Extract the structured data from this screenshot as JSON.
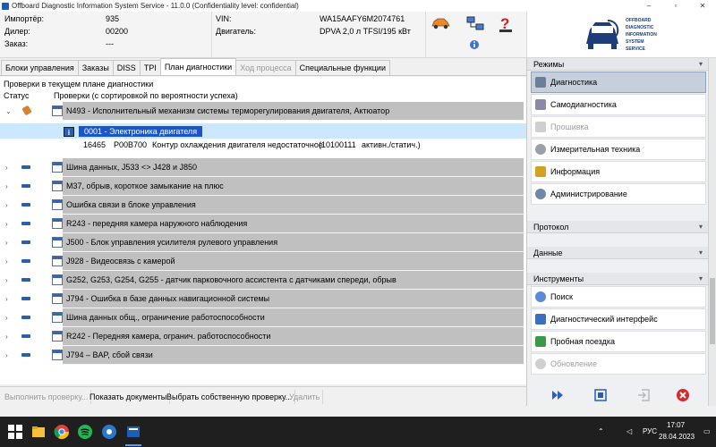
{
  "window": {
    "title": "Offboard Diagnostic Information System Service - 11.0.0 (Confidentiality level: confidential)",
    "minimize": "–",
    "maximize": "▫",
    "close": "✕"
  },
  "header": {
    "importer_label": "Импортёр:",
    "importer_value": "935",
    "dealer_label": "Дилер:",
    "dealer_value": "00200",
    "order_label": "Заказ:",
    "order_value": "---",
    "vin_label": "VIN:",
    "vin_value": "WA15AAFY6M2074761",
    "engine_label": "Двигатель:",
    "engine_value": "DPVA 2,0 л TFSI/195 кВт"
  },
  "logo": {
    "line1": "OFFBOARD",
    "line2": "DIAGNOSTIC",
    "line3": "INFORMATION",
    "line4": "SYSTEM",
    "line5": "SERVICE"
  },
  "tabs": [
    {
      "label": "Блоки управления"
    },
    {
      "label": "Заказы"
    },
    {
      "label": "DISS"
    },
    {
      "label": "TPI"
    },
    {
      "label": "План диагностики"
    },
    {
      "label": "Ход процесса"
    },
    {
      "label": "Специальные функции"
    }
  ],
  "main": {
    "caption": "Проверки в текущем плане диагностики",
    "col_status": "Статус",
    "col_checks": "Проверки (с сортировкой по вероятности успеха)",
    "first_row": "N493 - Исполнительный механизм системы терморегулирования двигателя, Актюатор",
    "sub_selected": "0001 - Электроника двигателя",
    "sub_info_icon": "i",
    "detail_code": "16465",
    "detail_pcode": "P00B700",
    "detail_text": "Контур охлаждения двигателя недостаточное",
    "detail_bits": "(10100111",
    "detail_state": "активн./статич.)",
    "rows": [
      "Шина данных, J533 <> J428 и J850",
      "M37, обрыв, короткое замыкание на плюс",
      "Ошибка связи в блоке управления",
      "R243 - передняя камера наружного наблюдения",
      "J500 - Блок управления усилителя рулевого управления",
      "J928 - Видеосвязь с камерой",
      "G252, G253, G254, G255 - датчик парковочного ассистента с датчиками спереди, обрыв",
      "J794 - Ошибка в базе данных навигационной системы",
      "Шина данных общ., ограничение работоспособности",
      "R242 - Передняя камера, огранич. работоспособности",
      "J794 – BAP, сбой связи"
    ]
  },
  "bottombar": {
    "run_check": "Выполнить проверку...",
    "show_docs": "Показать документы",
    "choose_own": "Выбрать собственную проверку...",
    "delete": "Удалить"
  },
  "rpanel": {
    "modes_title": "Режимы",
    "modes": [
      {
        "label": "Диагностика"
      },
      {
        "label": "Самодиагностика"
      },
      {
        "label": "Прошивка"
      },
      {
        "label": "Измерительная техника"
      },
      {
        "label": "Информация"
      },
      {
        "label": "Администрирование"
      }
    ],
    "protocol_title": "Протокол",
    "data_title": "Данные",
    "tools_title": "Инструменты",
    "tools": [
      {
        "label": "Поиск"
      },
      {
        "label": "Диагностический интерфейс"
      },
      {
        "label": "Пробная поездка"
      },
      {
        "label": "Обновление"
      }
    ],
    "expand_arrow": "▾"
  },
  "taskbar": {
    "lang": "РУС",
    "time": "17:07",
    "date": "28.04.2023"
  },
  "colors": {
    "selected_row": "#cce8ff",
    "selected_text_bg": "#1b55c9",
    "row_bar": "#c0c0c0",
    "accent": "#2a5fb0"
  }
}
